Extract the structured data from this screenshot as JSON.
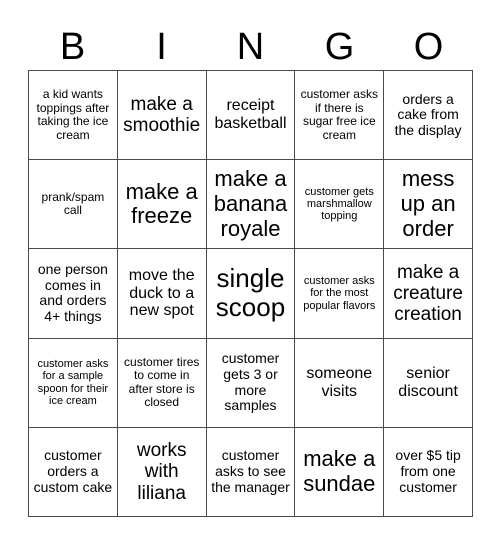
{
  "card": {
    "title_letters": [
      "B",
      "I",
      "N",
      "G",
      "O"
    ],
    "border_color": "#4a4a4a",
    "background_color": "#ffffff",
    "text_color": "#000000",
    "columns": 5,
    "rows": 5,
    "cells": [
      {
        "text": "a kid wants toppings after taking the ice cream",
        "size": "fs-sm"
      },
      {
        "text": "make a smoothie",
        "size": "fs-xl"
      },
      {
        "text": "receipt basketball",
        "size": "fs-lg"
      },
      {
        "text": "customer asks if there is sugar free ice cream",
        "size": "fs-sm"
      },
      {
        "text": "orders a cake from the display",
        "size": "fs-md"
      },
      {
        "text": "prank/spam call",
        "size": "fs-sm"
      },
      {
        "text": "make a freeze",
        "size": "fs-xxl"
      },
      {
        "text": "make a banana royale",
        "size": "fs-xxl"
      },
      {
        "text": "customer gets marshmallow topping",
        "size": "fs-xs"
      },
      {
        "text": "mess up an order",
        "size": "fs-xxl"
      },
      {
        "text": "one person comes in and orders 4+ things",
        "size": "fs-md"
      },
      {
        "text": "move the duck to a new spot",
        "size": "fs-lg"
      },
      {
        "text": "single scoop",
        "size": "fs-huge"
      },
      {
        "text": "customer asks for the most popular flavors",
        "size": "fs-xs"
      },
      {
        "text": "make a creature creation",
        "size": "fs-xl"
      },
      {
        "text": "customer asks for a sample spoon for their ice cream",
        "size": "fs-xs"
      },
      {
        "text": "customer tires to come in after store is closed",
        "size": "fs-sm"
      },
      {
        "text": "customer gets 3 or more samples",
        "size": "fs-md"
      },
      {
        "text": "someone visits",
        "size": "fs-lg"
      },
      {
        "text": "senior discount",
        "size": "fs-lg"
      },
      {
        "text": "customer orders a custom cake",
        "size": "fs-md"
      },
      {
        "text": "works with liliana",
        "size": "fs-xl"
      },
      {
        "text": "customer asks to see the manager",
        "size": "fs-md"
      },
      {
        "text": "make a sundae",
        "size": "fs-xxl"
      },
      {
        "text": "over $5 tip from one customer",
        "size": "fs-md"
      }
    ]
  }
}
